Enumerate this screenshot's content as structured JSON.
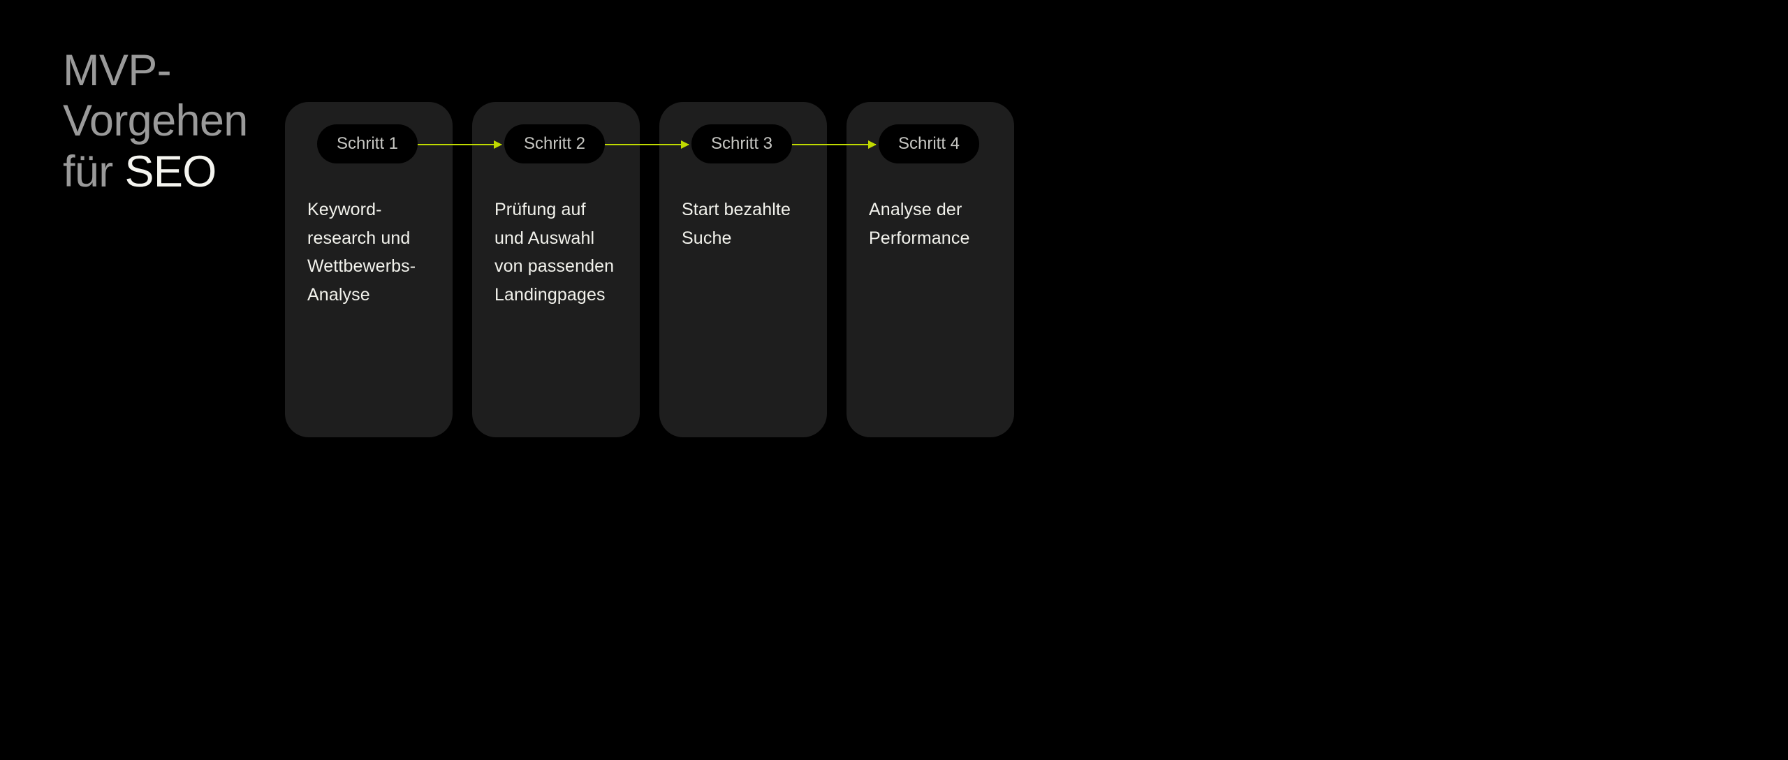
{
  "title": {
    "line1": "MVP-",
    "line2": "Vorgehen",
    "line3_muted": "für ",
    "line3_bright": "SEO"
  },
  "steps": [
    {
      "label": "Schritt 1",
      "text": "Keyword-research und Wettbewerbs-Analyse"
    },
    {
      "label": "Schritt 2",
      "text": "Prüfung auf und Auswahl von passenden Landingpages"
    },
    {
      "label": "Schritt 3",
      "text": "Start bezahlte Suche"
    },
    {
      "label": "Schritt 4",
      "text": "Analyse der Performance"
    }
  ],
  "colors": {
    "background": "#000000",
    "card": "#1e1e1e",
    "pill_bg": "#000000",
    "pill_text": "#c7c7c3",
    "body_text": "#f2f2ec",
    "title_muted": "#9a9a9a",
    "title_bright": "#f5f5f0",
    "arrow": "#c0da00"
  }
}
